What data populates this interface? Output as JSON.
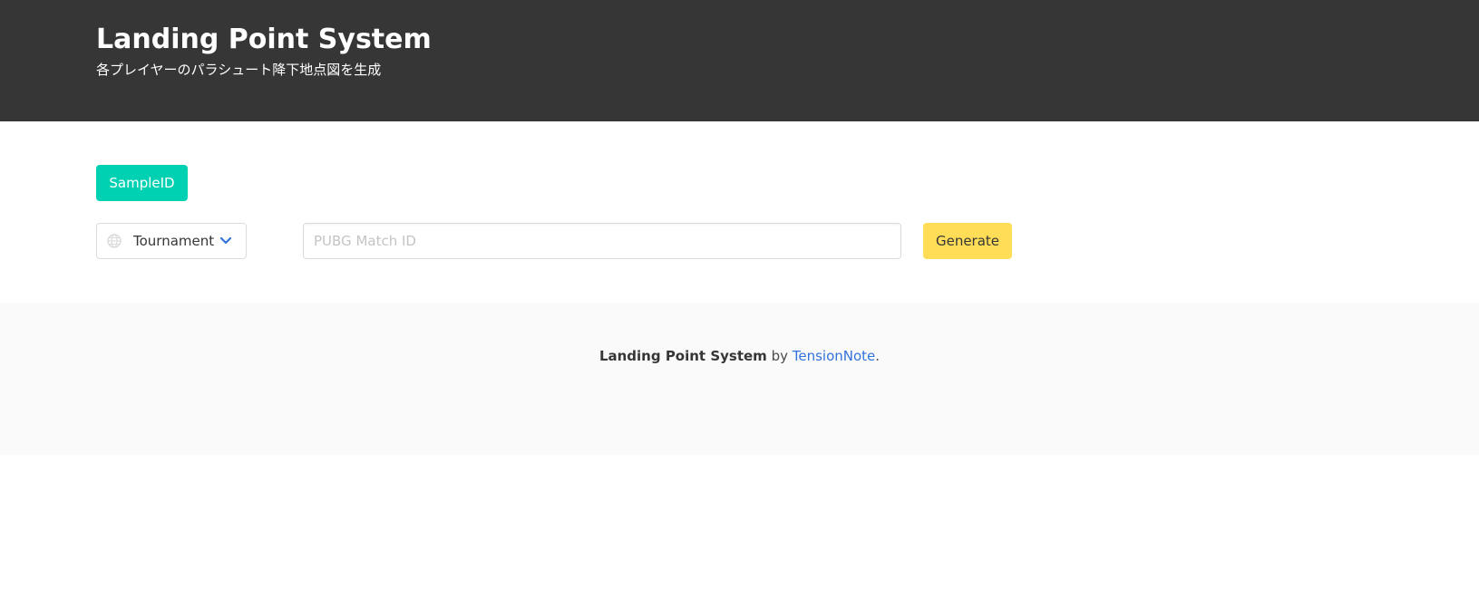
{
  "header": {
    "title": "Landing Point System",
    "subtitle": "各プレイヤーのパラシュート降下地点図を生成"
  },
  "controls": {
    "sample_button_label": "SampleID",
    "mode_select": {
      "selected": "Tournament",
      "icon": "globe-icon",
      "chevron": "chevron-down-icon"
    },
    "match_input": {
      "value": "",
      "placeholder": "PUBG Match ID"
    },
    "generate_button_label": "Generate"
  },
  "footer": {
    "brand": "Landing Point System",
    "by_text": " by ",
    "author_link": "TensionNote",
    "end_text": "."
  },
  "colors": {
    "hero_bg": "#363636",
    "primary": "#00d1b2",
    "warning": "#ffdd57",
    "link": "#3273dc",
    "footer_bg": "#fafafa"
  }
}
